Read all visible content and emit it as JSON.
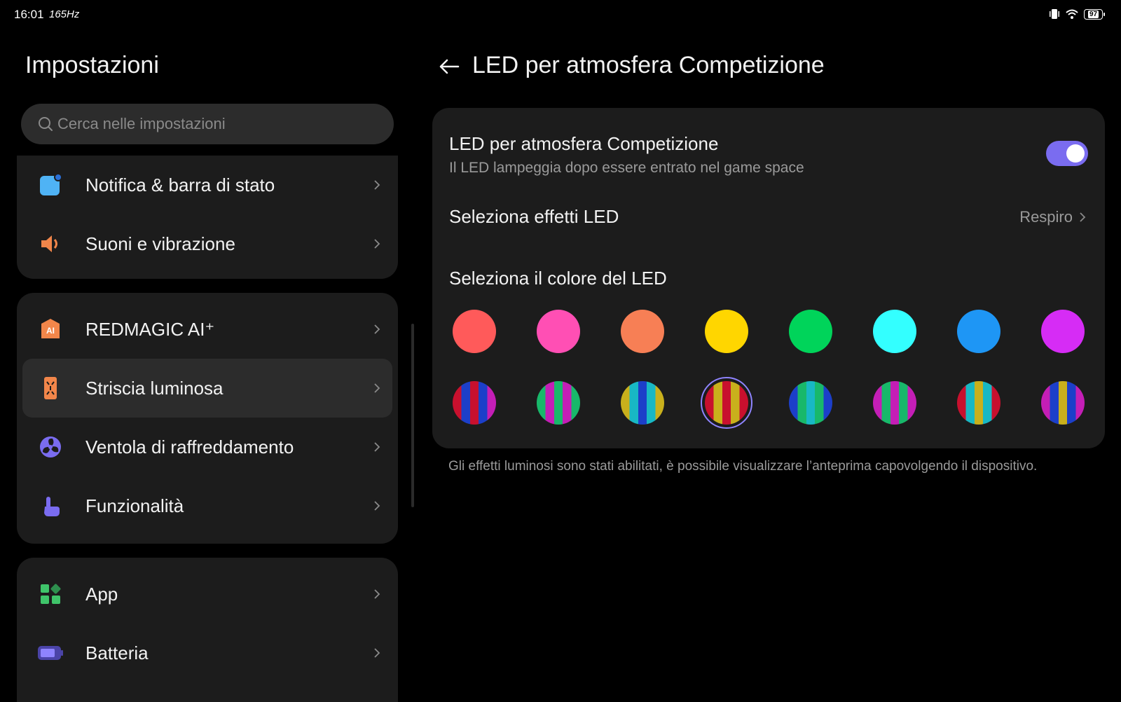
{
  "status_bar": {
    "time": "16:01",
    "refresh_rate": "165Hz",
    "battery": "97",
    "icons": [
      "vibrate-icon",
      "wifi-icon",
      "battery-icon"
    ]
  },
  "left": {
    "title": "Impostazioni",
    "search_placeholder": "Cerca nelle impostazioni",
    "groups": [
      {
        "items": [
          {
            "label": "Notifica & barra di stato",
            "icon": "notification-icon",
            "color": "#4fb3f5"
          },
          {
            "label": "Suoni e vibrazione",
            "icon": "speaker-icon",
            "color": "#f2864a"
          }
        ]
      },
      {
        "items": [
          {
            "label": "REDMAGIC AI⁺",
            "icon": "ai-icon",
            "color": "#f2864a"
          },
          {
            "label": "Striscia luminosa",
            "icon": "light-strip-icon",
            "color": "#f2864a",
            "selected": true
          },
          {
            "label": "Ventola di raffreddamento",
            "icon": "fan-icon",
            "color": "#7a6cf0"
          },
          {
            "label": "Funzionalità",
            "icon": "touch-icon",
            "color": "#7a6cf0"
          }
        ]
      },
      {
        "items": [
          {
            "label": "App",
            "icon": "apps-icon",
            "color": "#3fc46a"
          },
          {
            "label": "Batteria",
            "icon": "battery-setting-icon",
            "color": "#7a6cf0"
          }
        ]
      }
    ]
  },
  "right": {
    "title": "LED per atmosfera Competizione",
    "toggle": {
      "title": "LED per atmosfera Competizione",
      "subtitle": "Il LED lampeggia dopo essere entrato nel game space",
      "on": true
    },
    "effects": {
      "label": "Seleziona effetti LED",
      "value": "Respiro"
    },
    "colors": {
      "label": "Seleziona il colore del LED",
      "solid": [
        "#ff5a5a",
        "#ff4fb4",
        "#f77f55",
        "#ffd600",
        "#00d45a",
        "#33ffff",
        "#1e96f5",
        "#d62cf5"
      ],
      "striped": [
        [
          "#c8102e",
          "#1c3fc9",
          "#c8102e",
          "#1c3fc9",
          "#c41eb6"
        ],
        [
          "#18b86a",
          "#c41eb6",
          "#18b86a",
          "#c41eb6",
          "#18b86a"
        ],
        [
          "#c9b01c",
          "#18b8c4",
          "#1c3fc9",
          "#18b8c4",
          "#c9b01c"
        ],
        [
          "#c8102e",
          "#c9b01c",
          "#c8102e",
          "#c9b01c",
          "#c8102e"
        ],
        [
          "#1c3fc9",
          "#18b86a",
          "#18b8c4",
          "#18b86a",
          "#1c3fc9"
        ],
        [
          "#c41eb6",
          "#18b86a",
          "#c41eb6",
          "#18b86a",
          "#c41eb6"
        ],
        [
          "#c8102e",
          "#18b8c4",
          "#c9b01c",
          "#18b8c4",
          "#c8102e"
        ],
        [
          "#c41eb6",
          "#1c3fc9",
          "#c9b01c",
          "#1c3fc9",
          "#c41eb6"
        ]
      ],
      "selected_striped_index": 3
    },
    "footnote": "Gli effetti luminosi sono stati abilitati, è possibile visualizzare l’anteprima capovolgendo il dispositivo."
  }
}
